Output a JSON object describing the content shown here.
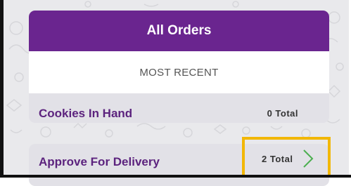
{
  "orders": {
    "header_title": "All Orders",
    "subheader": "MOST RECENT",
    "cookies_in_hand": {
      "label": "Cookies In Hand",
      "count": "0 Total"
    },
    "approve_for_delivery": {
      "label": "Approve For Delivery",
      "count": "2 Total"
    }
  },
  "colors": {
    "brand_purple": "#6a258f",
    "highlight_yellow": "#f2b705",
    "chevron_green": "#4caf50"
  }
}
